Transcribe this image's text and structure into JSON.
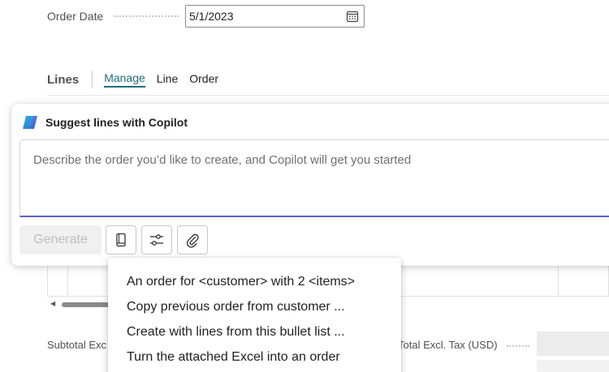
{
  "order_date": {
    "label": "Order Date",
    "value": "5/1/2023",
    "icon": "calendar-icon"
  },
  "lines": {
    "title": "Lines",
    "tabs": [
      {
        "label": "Manage",
        "active": true
      },
      {
        "label": "Line",
        "active": false
      },
      {
        "label": "Order",
        "active": false
      }
    ]
  },
  "copilot": {
    "title": "Suggest lines with Copilot",
    "logo": "copilot-logo-icon",
    "placeholder": "Describe the order you’d like to create, and Copilot will get you started",
    "generate_label": "Generate",
    "accent_color": "#5b5fc7",
    "tools": [
      "prompt-guide-icon",
      "settings-sliders-icon",
      "attach-icon"
    ]
  },
  "prompt_menu": {
    "items": [
      "An order for <customer> with 2 <items>",
      "Copy previous order from customer ...",
      "Create with lines from this bullet list ...",
      "Turn the attached Excel into an order"
    ]
  },
  "totals": {
    "subtotal_label": "Subtotal Exc",
    "total_label": "Total Excl. Tax (USD)"
  },
  "colors": {
    "link_teal": "#1a6e78"
  }
}
